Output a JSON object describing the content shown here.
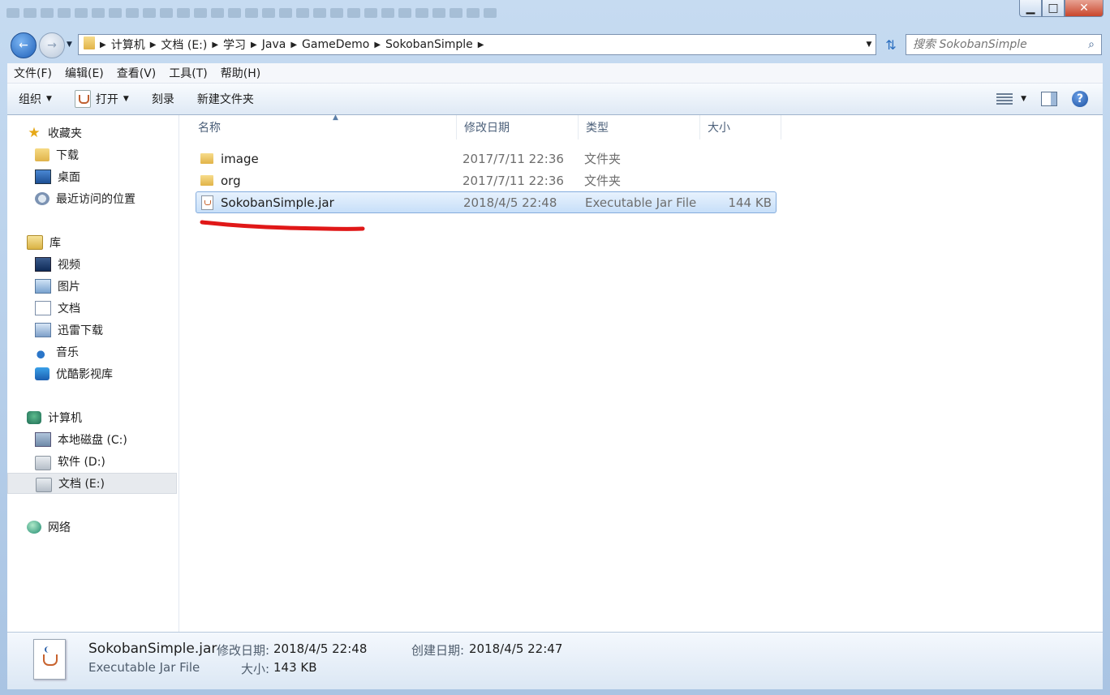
{
  "window": {
    "minimize": "▁",
    "maximize": "□",
    "close": "✕"
  },
  "address": {
    "crumbs": [
      "计算机",
      "文档 (E:)",
      "学习",
      "Java",
      "GameDemo",
      "SokobanSimple"
    ],
    "search_placeholder": "搜索 SokobanSimple"
  },
  "menu": [
    "文件(F)",
    "编辑(E)",
    "查看(V)",
    "工具(T)",
    "帮助(H)"
  ],
  "commands": {
    "organize": "组织",
    "open": "打开",
    "burn": "刻录",
    "new_folder": "新建文件夹"
  },
  "nav": {
    "favorites": {
      "label": "收藏夹",
      "items": [
        "下载",
        "桌面",
        "最近访问的位置"
      ]
    },
    "libraries": {
      "label": "库",
      "items": [
        "视频",
        "图片",
        "文档",
        "迅雷下载",
        "音乐",
        "优酷影视库"
      ]
    },
    "computer": {
      "label": "计算机",
      "items": [
        "本地磁盘 (C:)",
        "软件 (D:)",
        "文档 (E:)"
      ],
      "selected": "文档 (E:)"
    },
    "network": {
      "label": "网络"
    }
  },
  "columns": {
    "name": "名称",
    "modified": "修改日期",
    "type": "类型",
    "size": "大小"
  },
  "files": [
    {
      "name": "image",
      "modified": "2017/7/11 22:36",
      "type": "文件夹",
      "size": "",
      "kind": "folder"
    },
    {
      "name": "org",
      "modified": "2017/7/11 22:36",
      "type": "文件夹",
      "size": "",
      "kind": "folder"
    },
    {
      "name": "SokobanSimple.jar",
      "modified": "2018/4/5 22:48",
      "type": "Executable Jar File",
      "size": "144 KB",
      "kind": "jar",
      "selected": true
    }
  ],
  "details": {
    "filename": "SokobanSimple.jar",
    "type": "Executable Jar File",
    "modified_label": "修改日期:",
    "modified": "2018/4/5 22:48",
    "created_label": "创建日期:",
    "created": "2018/4/5 22:47",
    "size_label": "大小:",
    "size": "143 KB"
  },
  "colors": {
    "selection_bg": "#c7dff9",
    "selection_border": "#84acdd",
    "annotation_red": "#e01818"
  }
}
